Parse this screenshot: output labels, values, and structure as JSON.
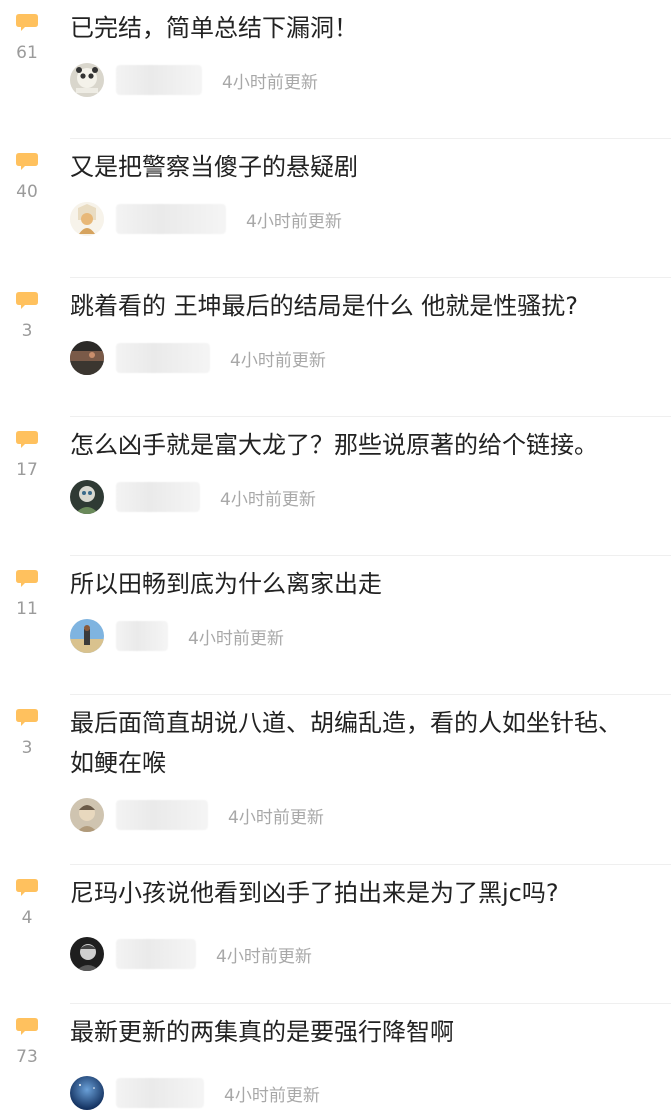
{
  "posts": [
    {
      "title": "已完结，简单总结下漏洞！",
      "comments": "61",
      "time": "4小时前更新",
      "avatar": "panda-meme-avatar"
    },
    {
      "title": "又是把警察当傻子的悬疑剧",
      "comments": "40",
      "time": "4小时前更新",
      "avatar": "cartoon-avatar"
    },
    {
      "title": "跳着看的 王坤最后的结局是什么 他就是性骚扰?",
      "comments": "3",
      "time": "4小时前更新",
      "avatar": "landscape-avatar"
    },
    {
      "title": "怎么凶手就是富大龙了？那些说原著的给个链接。",
      "comments": "17",
      "time": "4小时前更新",
      "avatar": "character-avatar"
    },
    {
      "title": "所以田畅到底为什么离家出走",
      "comments": "11",
      "time": "4小时前更新",
      "avatar": "beach-avatar"
    },
    {
      "title": "最后面简直胡说八道、胡编乱造，看的人如坐针毡、如鲠在喉",
      "comments": "3",
      "time": "4小时前更新",
      "avatar": "buddha-avatar"
    },
    {
      "title": "尼玛小孩说他看到凶手了拍出来是为了黑jc吗?",
      "comments": "4",
      "time": "4小时前更新",
      "avatar": "portrait-avatar"
    },
    {
      "title": "最新更新的两集真的是要强行降智啊",
      "comments": "73",
      "time": "4小时前更新",
      "avatar": "night-sky-avatar"
    }
  ],
  "colors": {
    "comment_icon": "#ffc15e",
    "count_text": "#9b9b9b",
    "title_text": "#222222",
    "time_text": "#a8a8a8",
    "divider": "#efefef"
  }
}
